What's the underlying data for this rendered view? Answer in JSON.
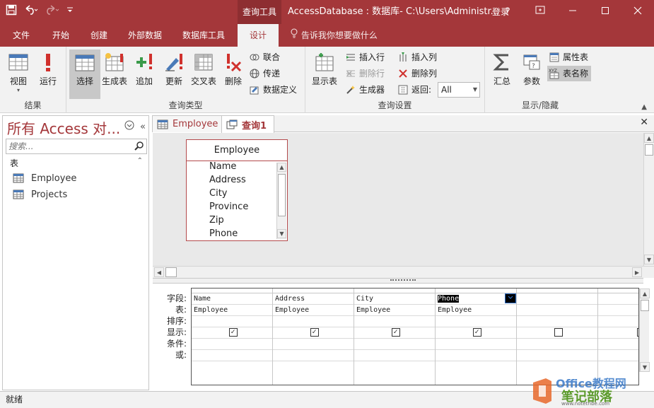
{
  "colors": {
    "brand": "#a4373a",
    "ribbon_bg": "#f2f2f2",
    "accent_blue": "#2b6cc4"
  },
  "titlebar": {
    "context_tool": "查询工具",
    "title": "AccessDatabase : 数据库- C:\\Users\\Administr...",
    "login": "登录",
    "help": "?",
    "icons": [
      "save-icon",
      "undo-icon",
      "redo-icon",
      "customize-qat-icon",
      "ribbon-display-icon",
      "minimize-icon",
      "maximize-icon",
      "close-icon"
    ]
  },
  "ribbon_tabs": [
    "文件",
    "开始",
    "创建",
    "外部数据",
    "数据库工具",
    "设计"
  ],
  "active_tab": "设计",
  "tell_me": "告诉我你想要做什么",
  "ribbon": {
    "results": {
      "label": "结果",
      "view": "视图",
      "run": "运行"
    },
    "query_type": {
      "label": "查询类型",
      "select": "选择",
      "make_table": "生成表",
      "append": "追加",
      "update": "更新",
      "crosstab": "交叉表",
      "delete": "删除",
      "union": "联合",
      "pass_through": "传递",
      "data_definition": "数据定义"
    },
    "query_setup": {
      "label": "查询设置",
      "show_table": "显示表",
      "insert_rows": "插入行",
      "delete_rows": "删除行",
      "builder": "生成器",
      "insert_columns": "插入列",
      "delete_columns": "删除列",
      "return_label": "返回:",
      "return_value": "All"
    },
    "show_hide": {
      "label": "显示/隐藏",
      "totals": "汇总",
      "parameters": "参数",
      "property_sheet": "属性表",
      "table_names": "表名称"
    }
  },
  "nav": {
    "title": "所有 Access 对...",
    "search_placeholder": "搜索...",
    "section": "表",
    "items": [
      "Employee",
      "Projects"
    ]
  },
  "doc_tabs": [
    {
      "label": "Employee"
    },
    {
      "label": "查询1"
    }
  ],
  "field_list": {
    "title": "Employee",
    "fields": [
      "Name",
      "Address",
      "City",
      "Province",
      "Zip",
      "Phone"
    ]
  },
  "qbe": {
    "row_labels": [
      "字段:",
      "表:",
      "排序:",
      "显示:",
      "条件:",
      "或:"
    ],
    "columns": [
      {
        "field": "Name",
        "table": "Employee",
        "show": "✓"
      },
      {
        "field": "Address",
        "table": "Employee",
        "show": "✓"
      },
      {
        "field": "City",
        "table": "Employee",
        "show": "✓"
      },
      {
        "field": "Phone",
        "table": "Employee",
        "show": "✓"
      },
      {
        "field": "",
        "table": "",
        "show": ""
      },
      {
        "field": "",
        "table": "",
        "show": ""
      }
    ]
  },
  "status": "就绪",
  "watermark": {
    "line1": "Office教程网",
    "line2": "笔记部落",
    "line3": "www.notetribe.com"
  }
}
